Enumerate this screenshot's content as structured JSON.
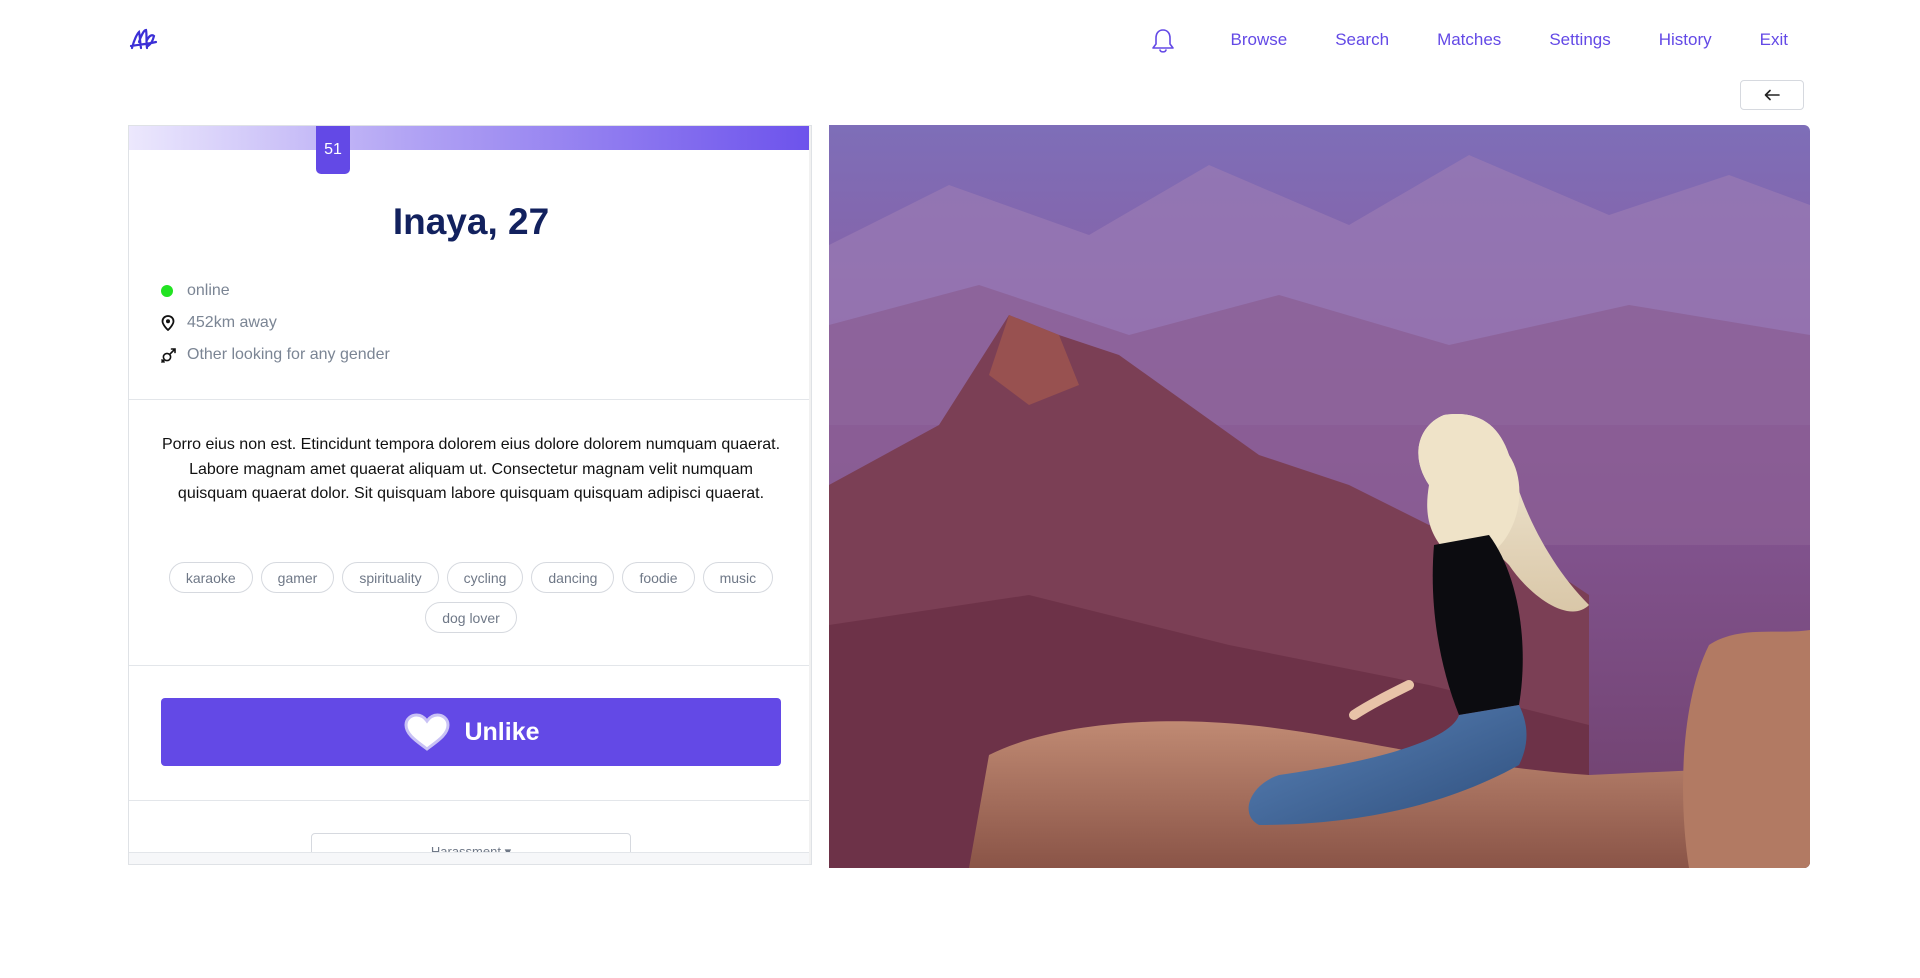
{
  "nav": {
    "logo_icon": "heart-logo-icon",
    "bell_icon": "bell-icon",
    "links": [
      "Browse",
      "Search",
      "Matches",
      "Settings",
      "History",
      "Exit"
    ]
  },
  "back_button": {
    "icon": "arrow-left-icon"
  },
  "profile": {
    "score": "51",
    "name": "Inaya, 27",
    "status": "online",
    "distance": "452km away",
    "orientation": "Other looking for any gender",
    "bio": "Porro eius non est. Etincidunt tempora dolorem eius dolore dolorem numquam quaerat. Labore magnam amet quaerat aliquam ut. Consectetur magnam velit numquam quisquam quaerat dolor. Sit quisquam labore quisquam quisquam adipisci quaerat.",
    "tags": [
      "karaoke",
      "gamer",
      "spirituality",
      "cycling",
      "dancing",
      "foodie",
      "music",
      "dog lover"
    ],
    "like_button": "Unlike",
    "report_label": "Harassment"
  },
  "colors": {
    "accent": "#6349e6",
    "name_color": "#12215e",
    "online": "#22e322"
  }
}
